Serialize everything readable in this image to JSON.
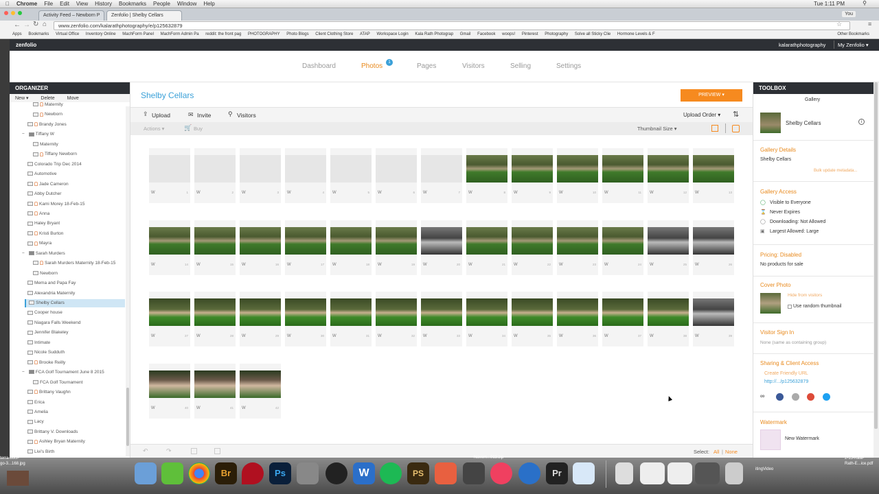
{
  "menubar": {
    "app": "Chrome",
    "items": [
      "File",
      "Edit",
      "View",
      "History",
      "Bookmarks",
      "People",
      "Window",
      "Help"
    ],
    "time": "Tue 1:11 PM"
  },
  "tabs": [
    "Activity Feed – Newborn P",
    "Zenfolio | Shelby Cellars"
  ],
  "user_tab": "You",
  "url": "www.zenfolio.com/kalarathphotography/e/p125632879",
  "bookmarks": [
    "Apps",
    "Bookmarks",
    "Virtual Office",
    "Inventory Online",
    "MachForm Panel",
    "MachForm Admin Pa",
    "reddit: the front pag",
    "PHOTOGRAPHY",
    "Photo Blogs",
    "Client Clothing Store",
    "ATAP",
    "Workspace Login",
    "Kala Rath Photograp",
    "Gmail",
    "Facebook",
    "woops!",
    "Pinterest",
    "Photography",
    "Solve all Sticky Clie",
    "Hormone Levels & F",
    "Other Bookmarks"
  ],
  "header": {
    "logo": "zenfolio",
    "account": "kalarathphotography",
    "my_zenfolio": "My Zenfolio ▾"
  },
  "nav": {
    "dashboard": "Dashboard",
    "photos": "Photos",
    "photos_badge": "1",
    "pages": "Pages",
    "visitors": "Visitors",
    "selling": "Selling",
    "settings": "Settings"
  },
  "organizer": {
    "title": "ORGANIZER",
    "new": "New ▾",
    "delete": "Delete",
    "move": "Move",
    "items": [
      {
        "label": "Maternity",
        "indent": 2,
        "lock": true
      },
      {
        "label": "Newborn",
        "indent": 2,
        "lock": true
      },
      {
        "label": "Brandy Jones",
        "indent": 1,
        "lock": true
      },
      {
        "label": "Tiffany W",
        "indent": 0,
        "group": true
      },
      {
        "label": "Maternity",
        "indent": 2,
        "lock": false
      },
      {
        "label": "Tiffany Newborn",
        "indent": 2,
        "lock": true
      },
      {
        "label": "Colorado Trip Dec 2014",
        "indent": 1,
        "lock": false
      },
      {
        "label": "Automotive",
        "indent": 1,
        "lock": false
      },
      {
        "label": "Jade Cameron",
        "indent": 1,
        "lock": true
      },
      {
        "label": "Abby Dutcher",
        "indent": 1,
        "lock": false
      },
      {
        "label": "Kami Morey 18-Feb-15",
        "indent": 1,
        "lock": true
      },
      {
        "label": "Anna",
        "indent": 1,
        "lock": true
      },
      {
        "label": "Haley Bryant",
        "indent": 1,
        "lock": false
      },
      {
        "label": "Kristi Burton",
        "indent": 1,
        "lock": true
      },
      {
        "label": "Mayra",
        "indent": 1,
        "lock": true
      },
      {
        "label": "Sarah Murders",
        "indent": 0,
        "group": true
      },
      {
        "label": "Sarah Murders Maternity 18-Feb-15",
        "indent": 2,
        "lock": true
      },
      {
        "label": "Newborn",
        "indent": 2,
        "lock": false
      },
      {
        "label": "Mema and Papa Fay",
        "indent": 1,
        "lock": false
      },
      {
        "label": "Alexandria Maternity",
        "indent": 1,
        "lock": false
      },
      {
        "label": "Shelby Cellars",
        "indent": 1,
        "lock": false,
        "selected": true
      },
      {
        "label": "Cooper house",
        "indent": 1,
        "lock": false
      },
      {
        "label": "Niagara Falls Weekend",
        "indent": 1,
        "lock": false
      },
      {
        "label": "Jennifer Blakeley",
        "indent": 1,
        "lock": false
      },
      {
        "label": "Intimate",
        "indent": 1,
        "lock": false
      },
      {
        "label": "Nicole Sudduth",
        "indent": 1,
        "lock": false
      },
      {
        "label": "Brooke Reilly",
        "indent": 1,
        "lock": true
      },
      {
        "label": "FCA Golf Tournament June 8 2015",
        "indent": 0,
        "group": true
      },
      {
        "label": "FCA Golf Tournament",
        "indent": 2,
        "lock": false
      },
      {
        "label": "Brittany Vaughn",
        "indent": 1,
        "lock": true
      },
      {
        "label": "Erica",
        "indent": 1,
        "lock": false
      },
      {
        "label": "Amelia",
        "indent": 1,
        "lock": false
      },
      {
        "label": "Lacy",
        "indent": 1,
        "lock": false
      },
      {
        "label": "Brittany V. Downloads",
        "indent": 1,
        "lock": false
      },
      {
        "label": "Ashley Bryan Maternity",
        "indent": 1,
        "lock": true
      },
      {
        "label": "Livi's Birth",
        "indent": 1,
        "lock": false
      }
    ]
  },
  "gallery": {
    "title": "Shelby Cellars",
    "preview": "PREVIEW ▾",
    "upload": "Upload",
    "invite": "Invite",
    "visitors": "Visitors",
    "upload_order": "Upload Order ▾",
    "actions": "Actions ▾",
    "buy": "Buy",
    "thumbnail_size": "Thumbnail Size ▾",
    "select_label": "Select:",
    "select_all": "All",
    "select_sep": "|",
    "select_none": "None",
    "thumbs": [
      {
        "n": "1",
        "type": "empty"
      },
      {
        "n": "2",
        "type": "empty"
      },
      {
        "n": "3",
        "type": "empty"
      },
      {
        "n": "4",
        "type": "empty"
      },
      {
        "n": "5",
        "type": "empty"
      },
      {
        "n": "6",
        "type": "empty"
      },
      {
        "n": "7",
        "type": "empty"
      },
      {
        "n": "8",
        "type": "orchard"
      },
      {
        "n": "9",
        "type": "orchard"
      },
      {
        "n": "10",
        "type": "orchard"
      },
      {
        "n": "11",
        "type": "orchard"
      },
      {
        "n": "12",
        "type": "orchard"
      },
      {
        "n": "13",
        "type": "orchard"
      },
      {
        "n": "14",
        "type": "orchard"
      },
      {
        "n": "15",
        "type": "orchard"
      },
      {
        "n": "16",
        "type": "orchard"
      },
      {
        "n": "17",
        "type": "orchard"
      },
      {
        "n": "18",
        "type": "orchard"
      },
      {
        "n": "19",
        "type": "orchard"
      },
      {
        "n": "20",
        "type": "bw"
      },
      {
        "n": "21",
        "type": "orchard"
      },
      {
        "n": "22",
        "type": "orchard"
      },
      {
        "n": "23",
        "type": "orchard"
      },
      {
        "n": "24",
        "type": "orchard"
      },
      {
        "n": "25",
        "type": "bw"
      },
      {
        "n": "26",
        "type": "bw"
      },
      {
        "n": "27",
        "type": "couple"
      },
      {
        "n": "28",
        "type": "couple"
      },
      {
        "n": "29",
        "type": "couple"
      },
      {
        "n": "30",
        "type": "couple"
      },
      {
        "n": "31",
        "type": "couple"
      },
      {
        "n": "32",
        "type": "couple"
      },
      {
        "n": "33",
        "type": "couple"
      },
      {
        "n": "34",
        "type": "couple"
      },
      {
        "n": "35",
        "type": "couple"
      },
      {
        "n": "36",
        "type": "couple"
      },
      {
        "n": "37",
        "type": "couple"
      },
      {
        "n": "38",
        "type": "couple"
      },
      {
        "n": "39",
        "type": "bw"
      },
      {
        "n": "40",
        "type": "family"
      },
      {
        "n": "41",
        "type": "family"
      },
      {
        "n": "42",
        "type": "family"
      }
    ],
    "thumb_w": "W"
  },
  "toolbox": {
    "title": "TOOLBOX",
    "gallery_label": "Gallery",
    "gallery_name": "Shelby Cellars",
    "details_title": "Gallery Details",
    "details_name": "Shelby Cellars",
    "bulk_update": "Bulk update metadata...",
    "access_title": "Gallery Access",
    "access_visible": "Visible to Everyone",
    "access_expires": "Never Expires",
    "access_download": "Downloading: Not Allowed",
    "access_largest": "Largest Allowed: Large",
    "pricing_title": "Pricing: Disabled",
    "pricing_text": "No products for sale",
    "cover_title": "Cover Photo",
    "cover_hide": "Hide from visitors",
    "cover_random": "Use random thumbnail",
    "signin_title": "Visitor Sign In",
    "signin_text": "None (same as containing group)",
    "sharing_title": "Sharing & Client Access",
    "sharing_create": "Create Friendly URL",
    "sharing_url": "http://.../p125632879",
    "watermark_title": "Watermark",
    "watermark_name": "New Watermark"
  },
  "desktop": {
    "left_file": "terra-bots-\ngo-3...168.jpg",
    "dock_file": "Novem...013.zip",
    "right_file": "2-15-Kala-\nRath-E...ice.pdf",
    "right_label": "itingVideo"
  },
  "colors": {
    "accent": "#f68a1f",
    "link": "#3aa0d8",
    "dark": "#2d3035"
  }
}
